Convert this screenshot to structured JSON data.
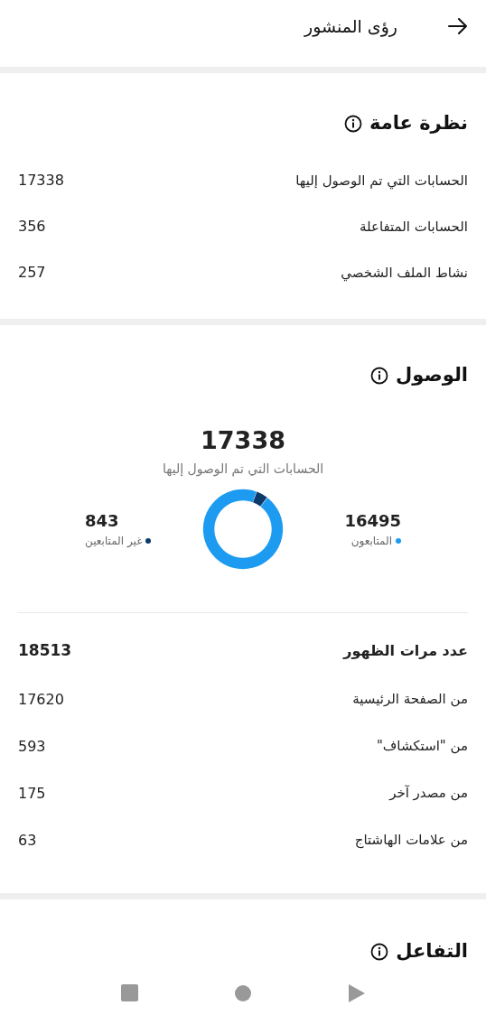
{
  "header": {
    "title": "رؤى المنشور"
  },
  "overview": {
    "title": "نظرة عامة",
    "rows": [
      {
        "label": "الحسابات التي تم الوصول إليها",
        "value": "17338"
      },
      {
        "label": "الحسابات المتفاعلة",
        "value": "356"
      },
      {
        "label": "نشاط الملف الشخصي",
        "value": "257"
      }
    ]
  },
  "reach": {
    "title": "الوصول",
    "total": "17338",
    "total_label": "الحسابات التي تم الوصول إليها",
    "legend": [
      {
        "value": "16495",
        "label": "المتابعون",
        "color": "#1d9bf0"
      },
      {
        "value": "843",
        "label": "غير المتابعين",
        "color": "#0c3b6b"
      }
    ],
    "chart_data": {
      "type": "donut",
      "values": [
        95.14,
        4.86
      ]
    },
    "impressions": {
      "label": "عدد مرات الظهور",
      "value": "18513"
    },
    "sources": [
      {
        "label": "من الصفحة الرئيسية",
        "value": "17620"
      },
      {
        "label": "من \"استكشاف\"",
        "value": "593"
      },
      {
        "label": "من مصدر آخر",
        "value": "175"
      },
      {
        "label": "من علامات الهاشتاج",
        "value": "63"
      }
    ]
  },
  "engagement": {
    "title": "التفاعل"
  }
}
